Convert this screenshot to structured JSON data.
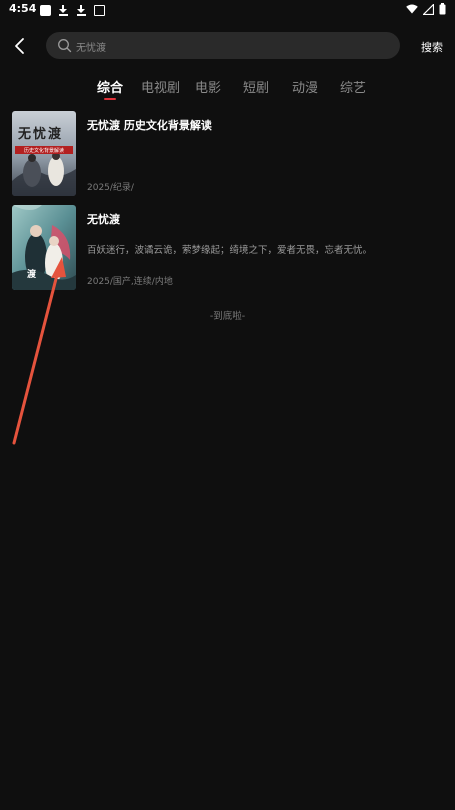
{
  "status_bar": {
    "time": "4:54"
  },
  "header": {
    "search_placeholder": "无忧渡",
    "search_button_label": "搜索"
  },
  "tabs": [
    {
      "label": "综合",
      "active": true
    },
    {
      "label": "电视剧",
      "active": false
    },
    {
      "label": "电影",
      "active": false
    },
    {
      "label": "短剧",
      "active": false
    },
    {
      "label": "动漫",
      "active": false
    },
    {
      "label": "综艺",
      "active": false
    }
  ],
  "results": [
    {
      "title": "无忧渡 历史文化背景解读",
      "description": "",
      "meta": "2025/纪录/",
      "poster_text": "无忧渡",
      "poster_banner": "历史文化背景解读"
    },
    {
      "title": "无忧渡",
      "description": "百妖迷行，波谲云诡，萦梦缘起；绮境之下，爱者无畏，忘者无忧。",
      "meta": "2025/国产,连续/内地"
    }
  ],
  "end_text": "-到底啦-",
  "colors": {
    "background": "#0f0f0f",
    "accent": "#e0323a",
    "annotation_arrow": "#e5533d"
  }
}
